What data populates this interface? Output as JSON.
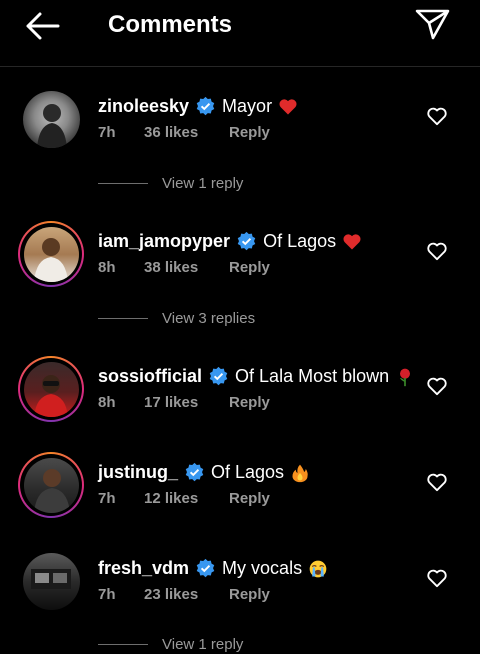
{
  "header": {
    "title": "Comments",
    "back_icon": "arrow-left-icon",
    "send_icon": "paper-plane-icon"
  },
  "comments": [
    {
      "username": "zinoleesky",
      "text": "Mayor",
      "emoji": "red-heart",
      "time": "7h",
      "likes": "36 likes",
      "reply": "Reply",
      "view_replies": "View 1 reply",
      "ring": false
    },
    {
      "username": "iam_jamopyper",
      "text": "Of Lagos",
      "emoji": "red-heart",
      "time": "8h",
      "likes": "38 likes",
      "reply": "Reply",
      "view_replies": "View 3 replies",
      "ring": true
    },
    {
      "username": "sossiofficial",
      "text": "Of Lala Most blown",
      "emoji": "rose",
      "time": "8h",
      "likes": "17 likes",
      "reply": "Reply",
      "view_replies": "",
      "ring": true
    },
    {
      "username": "justinug_",
      "text": "Of Lagos",
      "emoji": "fire",
      "time": "7h",
      "likes": "12 likes",
      "reply": "Reply",
      "view_replies": "",
      "ring": true
    },
    {
      "username": "fresh_vdm",
      "text": "My vocals",
      "emoji": "crying-face",
      "time": "7h",
      "likes": "23 likes",
      "reply": "Reply",
      "view_replies": "View 1 reply",
      "ring": false
    }
  ],
  "colors": {
    "background": "#000000",
    "secondary_text": "#9a9a9a",
    "verified_blue": "#3897f0",
    "heart_red": "#ed4956"
  }
}
